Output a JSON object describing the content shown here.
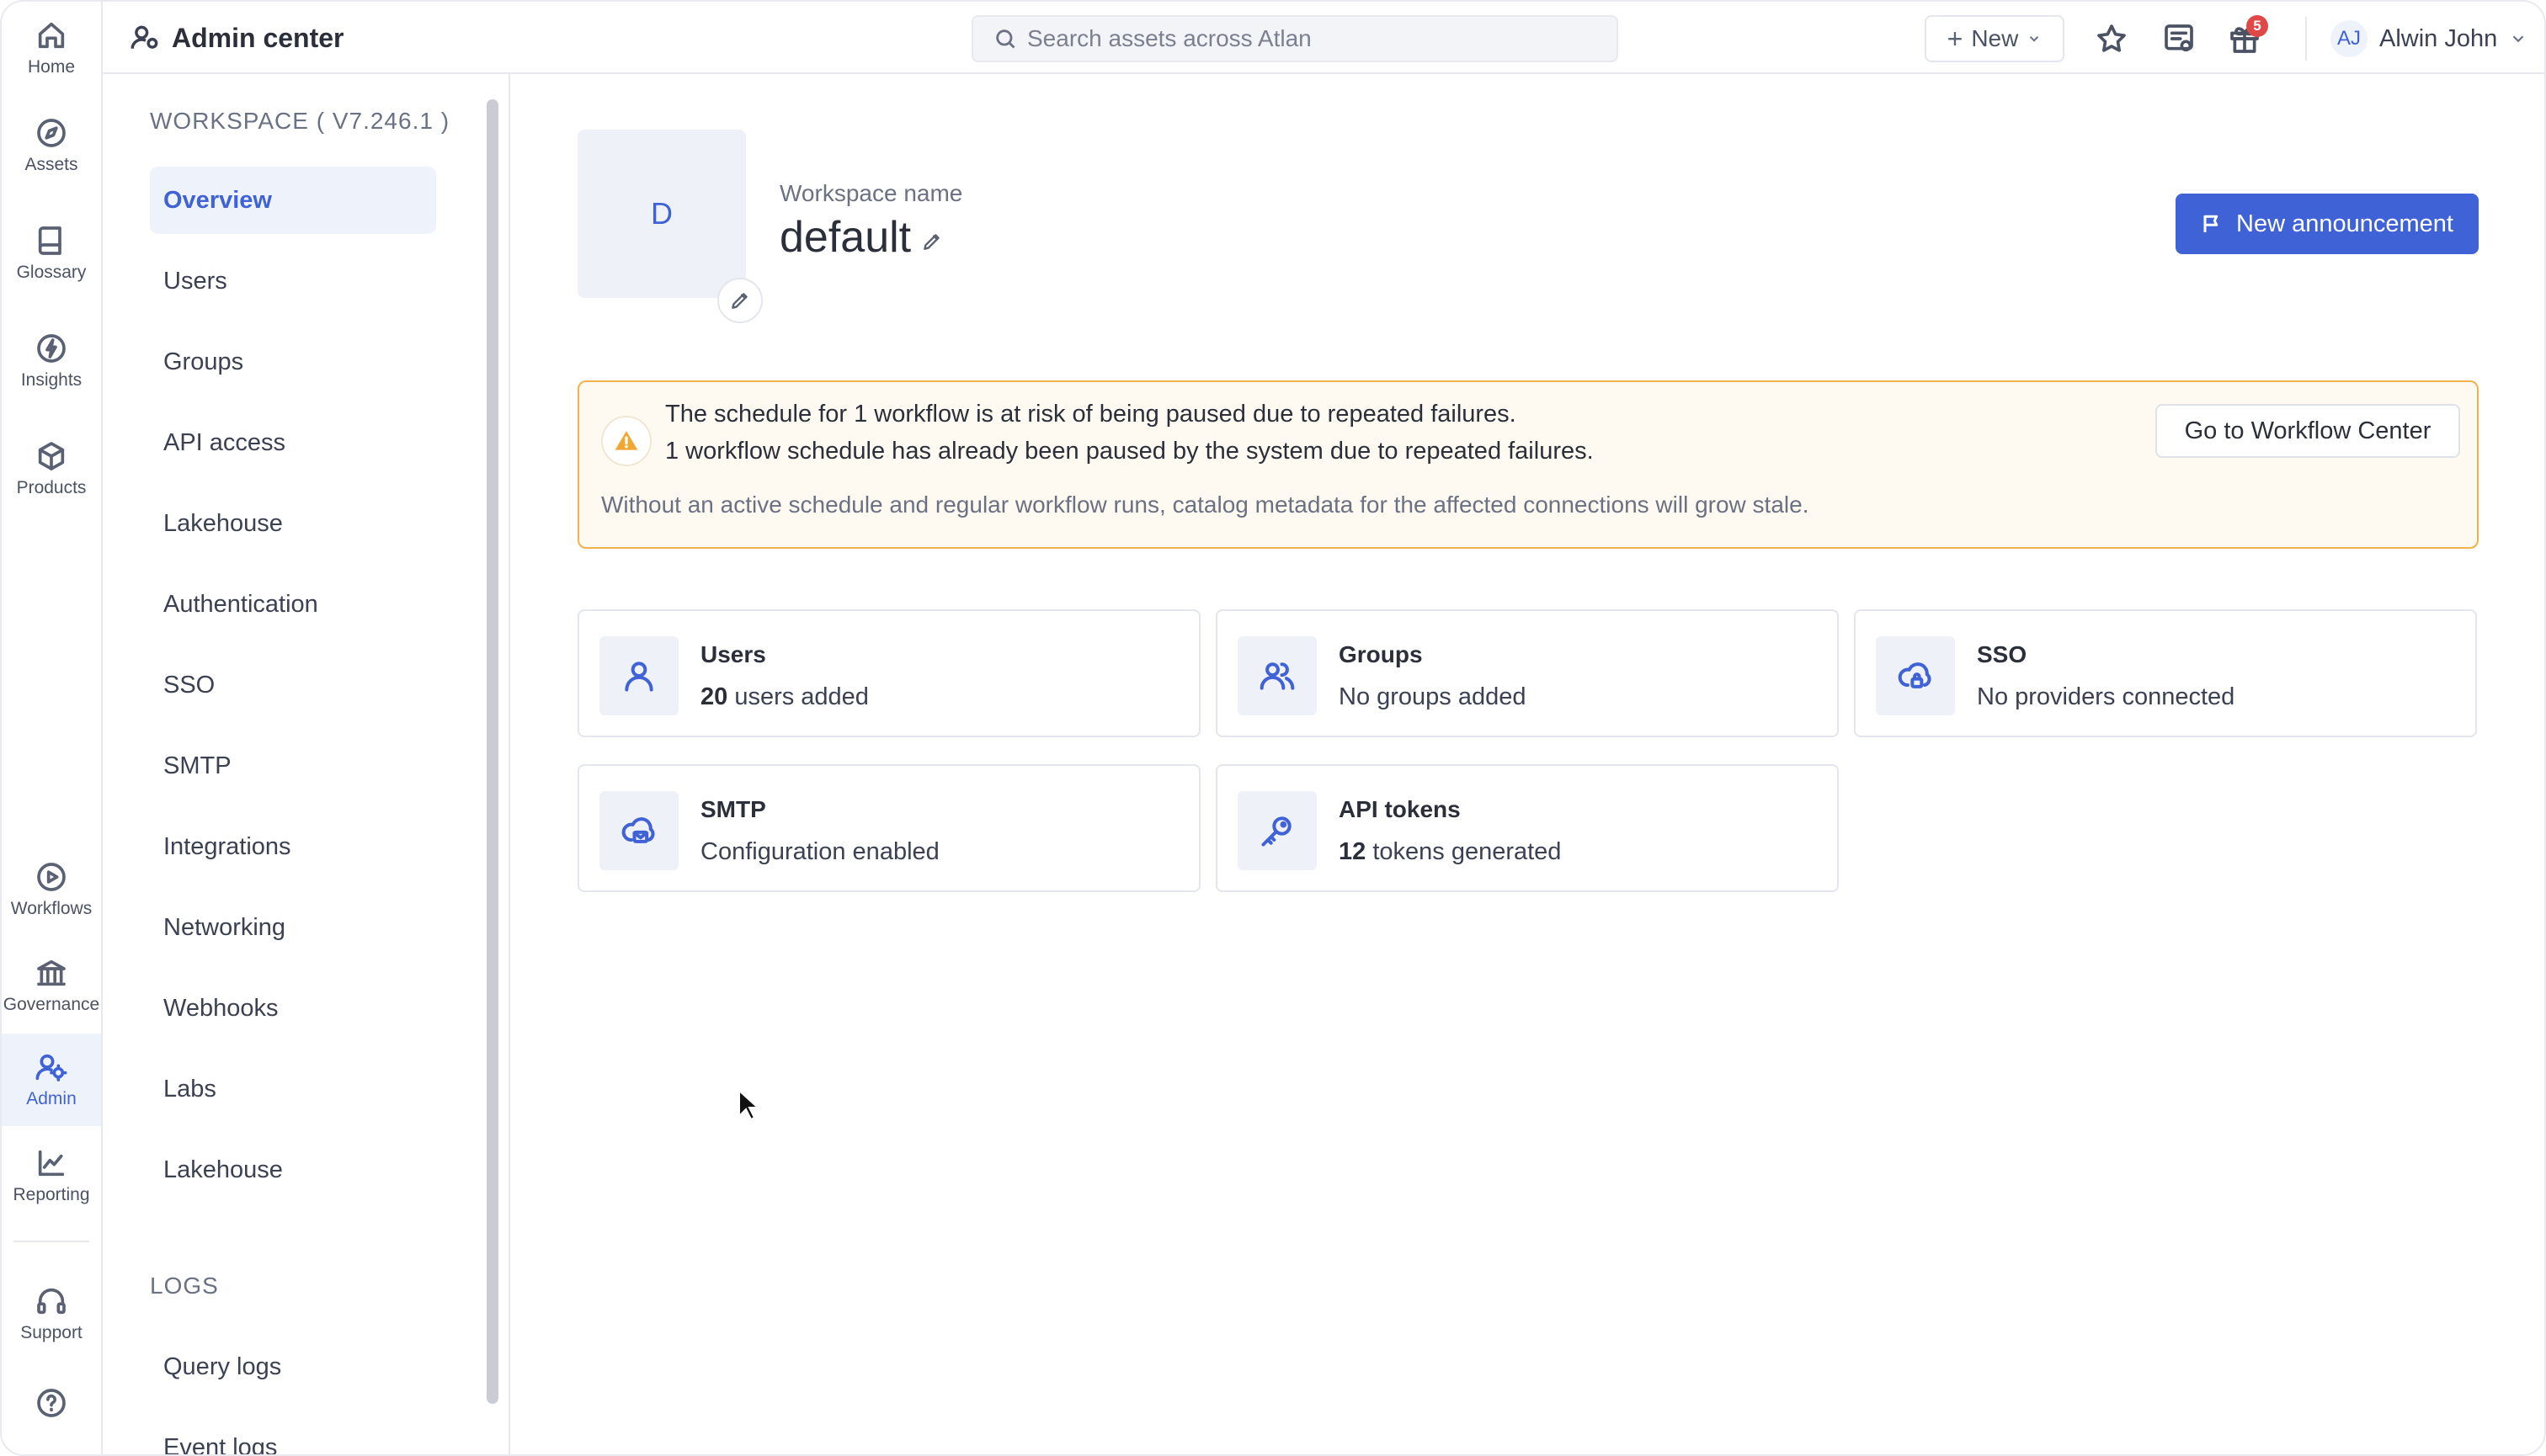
{
  "rail": {
    "items": [
      {
        "label": "Home",
        "icon": "home-icon"
      },
      {
        "label": "Assets",
        "icon": "compass-icon"
      },
      {
        "label": "Glossary",
        "icon": "book-icon"
      },
      {
        "label": "Insights",
        "icon": "bolt-icon"
      },
      {
        "label": "Products",
        "icon": "cube-icon"
      },
      {
        "label": "Workflows",
        "icon": "play-icon"
      },
      {
        "label": "Governance",
        "icon": "bank-icon"
      },
      {
        "label": "Admin",
        "icon": "admin-icon",
        "active": true
      },
      {
        "label": "Reporting",
        "icon": "chart-icon"
      },
      {
        "label": "Support",
        "icon": "headset-icon"
      }
    ]
  },
  "header": {
    "title": "Admin center",
    "search_placeholder": "Search assets across Atlan",
    "new_label": "New",
    "gift_badge": "5",
    "user_initials": "AJ",
    "user_name": "Alwin John"
  },
  "subnav": {
    "workspace_title": "WORKSPACE ( V7.246.1 )",
    "items": [
      {
        "label": "Overview",
        "active": true
      },
      {
        "label": "Users"
      },
      {
        "label": "Groups"
      },
      {
        "label": "API access"
      },
      {
        "label": "Lakehouse"
      },
      {
        "label": "Authentication"
      },
      {
        "label": "SSO"
      },
      {
        "label": "SMTP"
      },
      {
        "label": "Integrations"
      },
      {
        "label": "Networking"
      },
      {
        "label": "Webhooks"
      },
      {
        "label": "Labs"
      },
      {
        "label": "Lakehouse"
      }
    ],
    "logs_title": "LOGS",
    "logs_items": [
      {
        "label": "Query logs"
      },
      {
        "label": "Event logs"
      }
    ]
  },
  "workspace": {
    "avatar_letter": "D",
    "name_label": "Workspace name",
    "name": "default",
    "announce_label": "New announcement"
  },
  "alert": {
    "line1": "The schedule for 1 workflow is at risk of being paused due to repeated failures.",
    "line2": "1 workflow schedule has already been paused by the system due to repeated failures.",
    "line3": "Without an active schedule and regular workflow runs, catalog metadata for the affected connections will grow stale.",
    "button_label": "Go to Workflow Center",
    "accent": "#f2b24c"
  },
  "cards": [
    {
      "title": "Users",
      "count": "20",
      "subtitle": " users added",
      "icon": "user-icon"
    },
    {
      "title": "Groups",
      "count": "",
      "subtitle": "No groups added",
      "icon": "users-icon"
    },
    {
      "title": "SSO",
      "count": "",
      "subtitle": "No providers connected",
      "icon": "cloud-lock-icon"
    },
    {
      "title": "SMTP",
      "count": "",
      "subtitle": "Configuration enabled",
      "icon": "cloud-mail-icon"
    },
    {
      "title": "API tokens",
      "count": "12",
      "subtitle": " tokens generated",
      "icon": "key-icon"
    }
  ],
  "colors": {
    "accent": "#3f63d7",
    "warning": "#f2b24c",
    "badge": "#e04848"
  }
}
